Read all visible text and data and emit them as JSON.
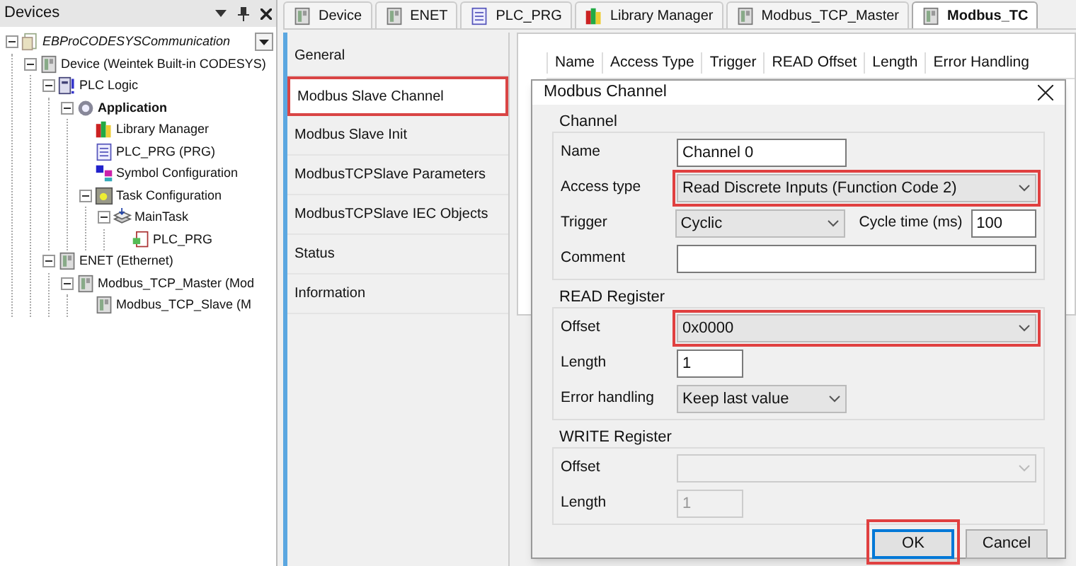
{
  "devices_panel": {
    "title": "Devices",
    "tree": [
      {
        "label": "EBProCODESYSCommunication",
        "kind": "project",
        "italic": true,
        "expanded": true,
        "children": [
          {
            "label": "Device (Weintek Built-in CODESYS)",
            "kind": "device",
            "expanded": true,
            "children": [
              {
                "label": "PLC Logic",
                "kind": "plc",
                "expanded": true,
                "children": [
                  {
                    "label": "Application",
                    "kind": "app",
                    "bold": true,
                    "expanded": true,
                    "children": [
                      {
                        "label": "Library Manager",
                        "kind": "library"
                      },
                      {
                        "label": "PLC_PRG (PRG)",
                        "kind": "pou"
                      },
                      {
                        "label": "Symbol Configuration",
                        "kind": "symbol"
                      },
                      {
                        "label": "Task Configuration",
                        "kind": "task",
                        "expanded": true,
                        "children": [
                          {
                            "label": "MainTask",
                            "kind": "maintask",
                            "expanded": true,
                            "children": [
                              {
                                "label": "PLC_PRG",
                                "kind": "call"
                              }
                            ]
                          }
                        ]
                      }
                    ]
                  }
                ]
              },
              {
                "label": "ENET (Ethernet)",
                "kind": "device",
                "expanded": true,
                "children": [
                  {
                    "label": "Modbus_TCP_Master (Mod",
                    "kind": "device",
                    "expanded": true,
                    "children": [
                      {
                        "label": "Modbus_TCP_Slave (M",
                        "kind": "device"
                      }
                    ]
                  }
                ]
              }
            ]
          }
        ]
      }
    ]
  },
  "tabs": [
    {
      "label": "Device",
      "kind": "device",
      "selected": false
    },
    {
      "label": "ENET",
      "kind": "device",
      "selected": false
    },
    {
      "label": "PLC_PRG",
      "kind": "pou",
      "selected": false
    },
    {
      "label": "Library Manager",
      "kind": "library",
      "selected": false
    },
    {
      "label": "Modbus_TCP_Master",
      "kind": "device",
      "selected": false
    },
    {
      "label": "Modbus_TC",
      "kind": "device",
      "selected": true
    }
  ],
  "sidebar": {
    "items": [
      {
        "label": "General",
        "selected": false,
        "highlighted": false
      },
      {
        "label": "Modbus Slave Channel",
        "selected": true,
        "highlighted": true
      },
      {
        "label": "Modbus Slave Init",
        "selected": false,
        "highlighted": false
      },
      {
        "label": "ModbusTCPSlave Parameters",
        "selected": false,
        "highlighted": false
      },
      {
        "label": "ModbusTCPSlave IEC Objects",
        "selected": false,
        "highlighted": false
      },
      {
        "label": "Status",
        "selected": false,
        "highlighted": false
      },
      {
        "label": "Information",
        "selected": false,
        "highlighted": false
      }
    ]
  },
  "table": {
    "columns": [
      "Name",
      "Access Type",
      "Trigger",
      "READ Offset",
      "Length",
      "Error Handling"
    ]
  },
  "dialog": {
    "title": "Modbus Channel",
    "groups": [
      {
        "title": "Channel",
        "rows": [
          {
            "label": "Name",
            "control": {
              "kind": "shorttext",
              "value": "Channel 0",
              "highlighted": false,
              "disabled": false
            }
          },
          {
            "label": "Access type",
            "control": {
              "kind": "select",
              "value": "Read Discrete Inputs (Function Code 2)",
              "highlighted": true,
              "disabled": false
            }
          },
          {
            "label": "Trigger",
            "control": {
              "kind": "shortselect",
              "value": "Cyclic",
              "highlighted": false,
              "disabled": false
            },
            "extra": {
              "label": "Cycle time (ms)",
              "value": "100"
            }
          },
          {
            "label": "Comment",
            "control": {
              "kind": "text",
              "highlighted": false,
              "disabled": false
            }
          }
        ]
      },
      {
        "title": "READ Register",
        "rows": [
          {
            "label": "Offset",
            "control": {
              "kind": "select",
              "value": "0x0000",
              "highlighted": true,
              "disabled": false
            }
          },
          {
            "label": "Length",
            "control": {
              "kind": "tinytext",
              "value": "1",
              "highlighted": false,
              "disabled": false
            }
          },
          {
            "label": "Error handling",
            "control": {
              "kind": "shortselect",
              "value": "Keep last value",
              "highlighted": false,
              "disabled": false
            }
          }
        ]
      },
      {
        "title": "WRITE Register",
        "rows": [
          {
            "label": "Offset",
            "control": {
              "kind": "select",
              "highlighted": false,
              "disabled": true
            }
          },
          {
            "label": "Length",
            "control": {
              "kind": "tinytext",
              "value": "1",
              "highlighted": false,
              "disabled": true
            }
          }
        ]
      }
    ],
    "buttons": [
      {
        "label": "OK",
        "default": true,
        "highlighted": true
      },
      {
        "label": "Cancel",
        "default": false,
        "highlighted": false
      }
    ]
  }
}
